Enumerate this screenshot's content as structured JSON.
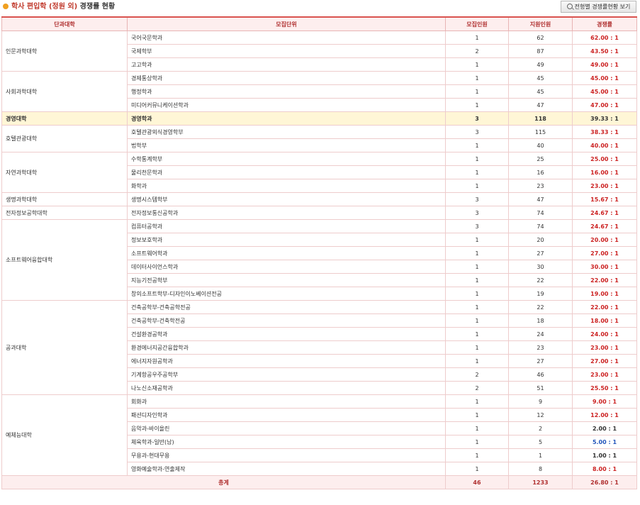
{
  "header": {
    "title_part1": "학사 편입학 (정원 외)",
    "title_part2": "경쟁률 현황",
    "button_label": "전형별 경쟁률현황 보기"
  },
  "colors": {
    "red": "#cc2222",
    "dark": "#333333",
    "blue": "#2255bb"
  },
  "table": {
    "columns": [
      "단과대학",
      "모집단위",
      "모집인원",
      "지원인원",
      "경쟁률"
    ],
    "rows": [
      {
        "college": "인문과학대학",
        "unit": "국어국문학과",
        "quota": "1",
        "applicants": "62",
        "rate": "62.00 : 1",
        "rate_color": "red"
      },
      {
        "college": "",
        "unit": "국제학부",
        "quota": "2",
        "applicants": "87",
        "rate": "43.50 : 1",
        "rate_color": "red"
      },
      {
        "college": "",
        "unit": "고고학과",
        "quota": "1",
        "applicants": "49",
        "rate": "49.00 : 1",
        "rate_color": "red"
      },
      {
        "college": "사회과학대학",
        "unit": "경제통상학과",
        "quota": "1",
        "applicants": "45",
        "rate": "45.00 : 1",
        "rate_color": "red"
      },
      {
        "college": "",
        "unit": "행정학과",
        "quota": "1",
        "applicants": "45",
        "rate": "45.00 : 1",
        "rate_color": "red"
      },
      {
        "college": "",
        "unit": "미디어커뮤니케이션학과",
        "quota": "1",
        "applicants": "47",
        "rate": "47.00 : 1",
        "rate_color": "red"
      },
      {
        "college": "경영대학",
        "unit": "경영학과",
        "quota": "3",
        "applicants": "118",
        "rate": "39.33 : 1",
        "rate_color": "dark"
      },
      {
        "college": "호텔관광대학",
        "unit": "호텔관광외식경영학부",
        "quota": "3",
        "applicants": "115",
        "rate": "38.33 : 1",
        "rate_color": "red"
      },
      {
        "college": "",
        "unit": "법학부",
        "quota": "1",
        "applicants": "40",
        "rate": "40.00 : 1",
        "rate_color": "red"
      },
      {
        "college": "자연과학대학",
        "unit": "수학통계학부",
        "quota": "1",
        "applicants": "25",
        "rate": "25.00 : 1",
        "rate_color": "red"
      },
      {
        "college": "",
        "unit": "물리천문학과",
        "quota": "1",
        "applicants": "16",
        "rate": "16.00 : 1",
        "rate_color": "red"
      },
      {
        "college": "",
        "unit": "화학과",
        "quota": "1",
        "applicants": "23",
        "rate": "23.00 : 1",
        "rate_color": "red"
      },
      {
        "college": "생명과학대학",
        "unit": "생명시스템학부",
        "quota": "3",
        "applicants": "47",
        "rate": "15.67 : 1",
        "rate_color": "red"
      },
      {
        "college": "전자정보공학대학",
        "unit": "전자정보통신공학과",
        "quota": "3",
        "applicants": "74",
        "rate": "24.67 : 1",
        "rate_color": "red"
      },
      {
        "college": "소프트웨어융합대학",
        "unit": "컴퓨터공학과",
        "quota": "3",
        "applicants": "74",
        "rate": "24.67 : 1",
        "rate_color": "red"
      },
      {
        "college": "",
        "unit": "정보보호학과",
        "quota": "1",
        "applicants": "20",
        "rate": "20.00 : 1",
        "rate_color": "red"
      },
      {
        "college": "",
        "unit": "소프트웨어학과",
        "quota": "1",
        "applicants": "27",
        "rate": "27.00 : 1",
        "rate_color": "red"
      },
      {
        "college": "",
        "unit": "데이터사이언스학과",
        "quota": "1",
        "applicants": "30",
        "rate": "30.00 : 1",
        "rate_color": "red"
      },
      {
        "college": "",
        "unit": "지능기전공학부",
        "quota": "1",
        "applicants": "22",
        "rate": "22.00 : 1",
        "rate_color": "red"
      },
      {
        "college": "",
        "unit": "창의소프트학부-디자인이노베이션전공",
        "quota": "1",
        "applicants": "19",
        "rate": "19.00 : 1",
        "rate_color": "red"
      },
      {
        "college": "공과대학",
        "unit": "건축공학부-건축공학전공",
        "quota": "1",
        "applicants": "22",
        "rate": "22.00 : 1",
        "rate_color": "red"
      },
      {
        "college": "",
        "unit": "건축공학부-건축학전공",
        "quota": "1",
        "applicants": "18",
        "rate": "18.00 : 1",
        "rate_color": "red"
      },
      {
        "college": "",
        "unit": "건설환경공학과",
        "quota": "1",
        "applicants": "24",
        "rate": "24.00 : 1",
        "rate_color": "red"
      },
      {
        "college": "",
        "unit": "환경에너지공간융합학과",
        "quota": "1",
        "applicants": "23",
        "rate": "23.00 : 1",
        "rate_color": "red"
      },
      {
        "college": "",
        "unit": "에너지자원공학과",
        "quota": "1",
        "applicants": "27",
        "rate": "27.00 : 1",
        "rate_color": "red"
      },
      {
        "college": "",
        "unit": "기계항공우주공학부",
        "quota": "2",
        "applicants": "46",
        "rate": "23.00 : 1",
        "rate_color": "red"
      },
      {
        "college": "",
        "unit": "나노신소재공학과",
        "quota": "2",
        "applicants": "51",
        "rate": "25.50 : 1",
        "rate_color": "red"
      },
      {
        "college": "예체능대학",
        "unit": "회화과",
        "quota": "1",
        "applicants": "9",
        "rate": "9.00 : 1",
        "rate_color": "red"
      },
      {
        "college": "",
        "unit": "패션디자인학과",
        "quota": "1",
        "applicants": "12",
        "rate": "12.00 : 1",
        "rate_color": "red"
      },
      {
        "college": "",
        "unit": "음악과-바이올린",
        "quota": "1",
        "applicants": "2",
        "rate": "2.00 : 1",
        "rate_color": "dark"
      },
      {
        "college": "",
        "unit": "체육학과-일반(남)",
        "quota": "1",
        "applicants": "5",
        "rate": "5.00 : 1",
        "rate_color": "blue"
      },
      {
        "college": "",
        "unit": "무용과-현대무용",
        "quota": "1",
        "applicants": "1",
        "rate": "1.00 : 1",
        "rate_color": "dark"
      },
      {
        "college": "",
        "unit": "영화예술학과-연출제작",
        "quota": "1",
        "applicants": "8",
        "rate": "8.00 : 1",
        "rate_color": "red"
      }
    ],
    "total": {
      "label": "총계",
      "quota": "46",
      "applicants": "1233",
      "rate": "26.80 : 1"
    }
  }
}
